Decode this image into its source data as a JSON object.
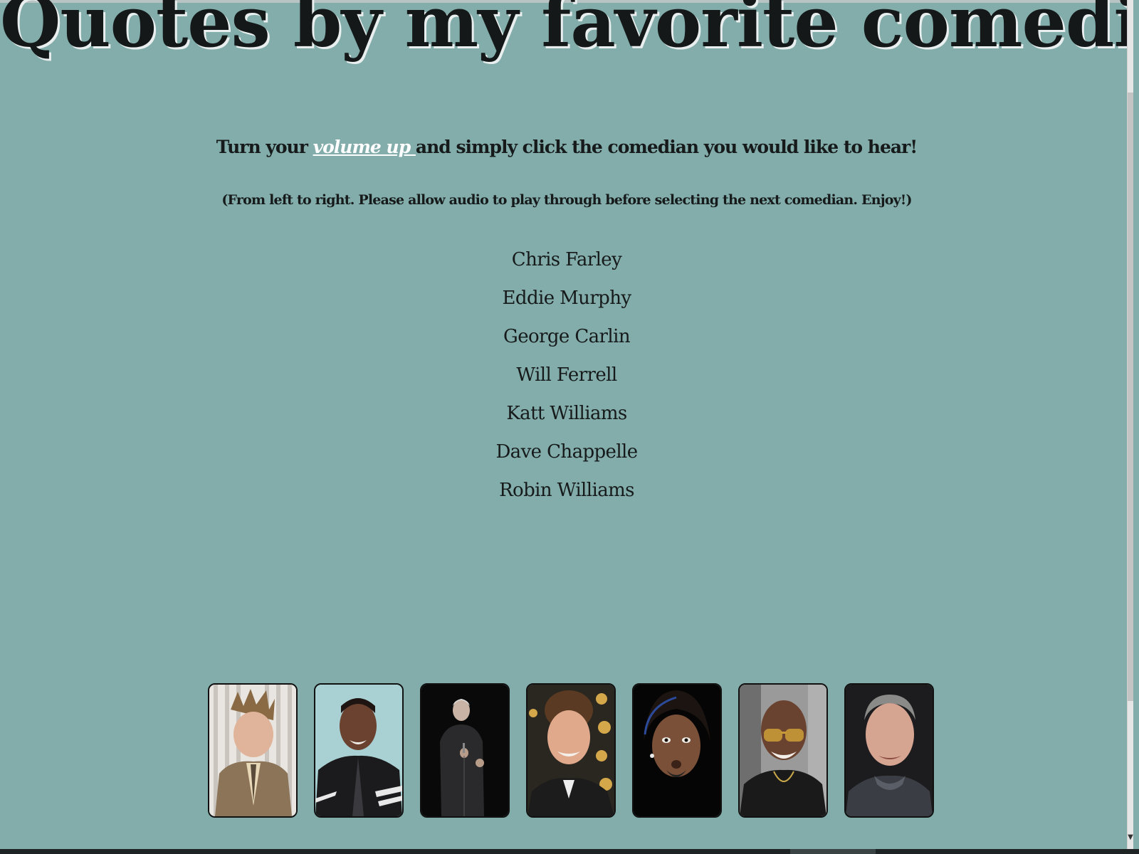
{
  "page": {
    "title": "Quotes by my favorite comedians!",
    "intro_before": "Turn your ",
    "intro_link": "volume up ",
    "intro_after": "and simply click the comedian you would like to hear!",
    "note": "(From left to right. Please allow audio to play through before selecting the next comedian. Enjoy!)"
  },
  "comedians": [
    {
      "name": "Chris Farley"
    },
    {
      "name": "Eddie Murphy"
    },
    {
      "name": "George Carlin"
    },
    {
      "name": "Will Ferrell"
    },
    {
      "name": "Katt Williams"
    },
    {
      "name": "Dave Chappelle"
    },
    {
      "name": "Robin Williams"
    }
  ],
  "colors": {
    "background": "#82adab",
    "text": "#161a1a",
    "link": "#ffffff"
  }
}
